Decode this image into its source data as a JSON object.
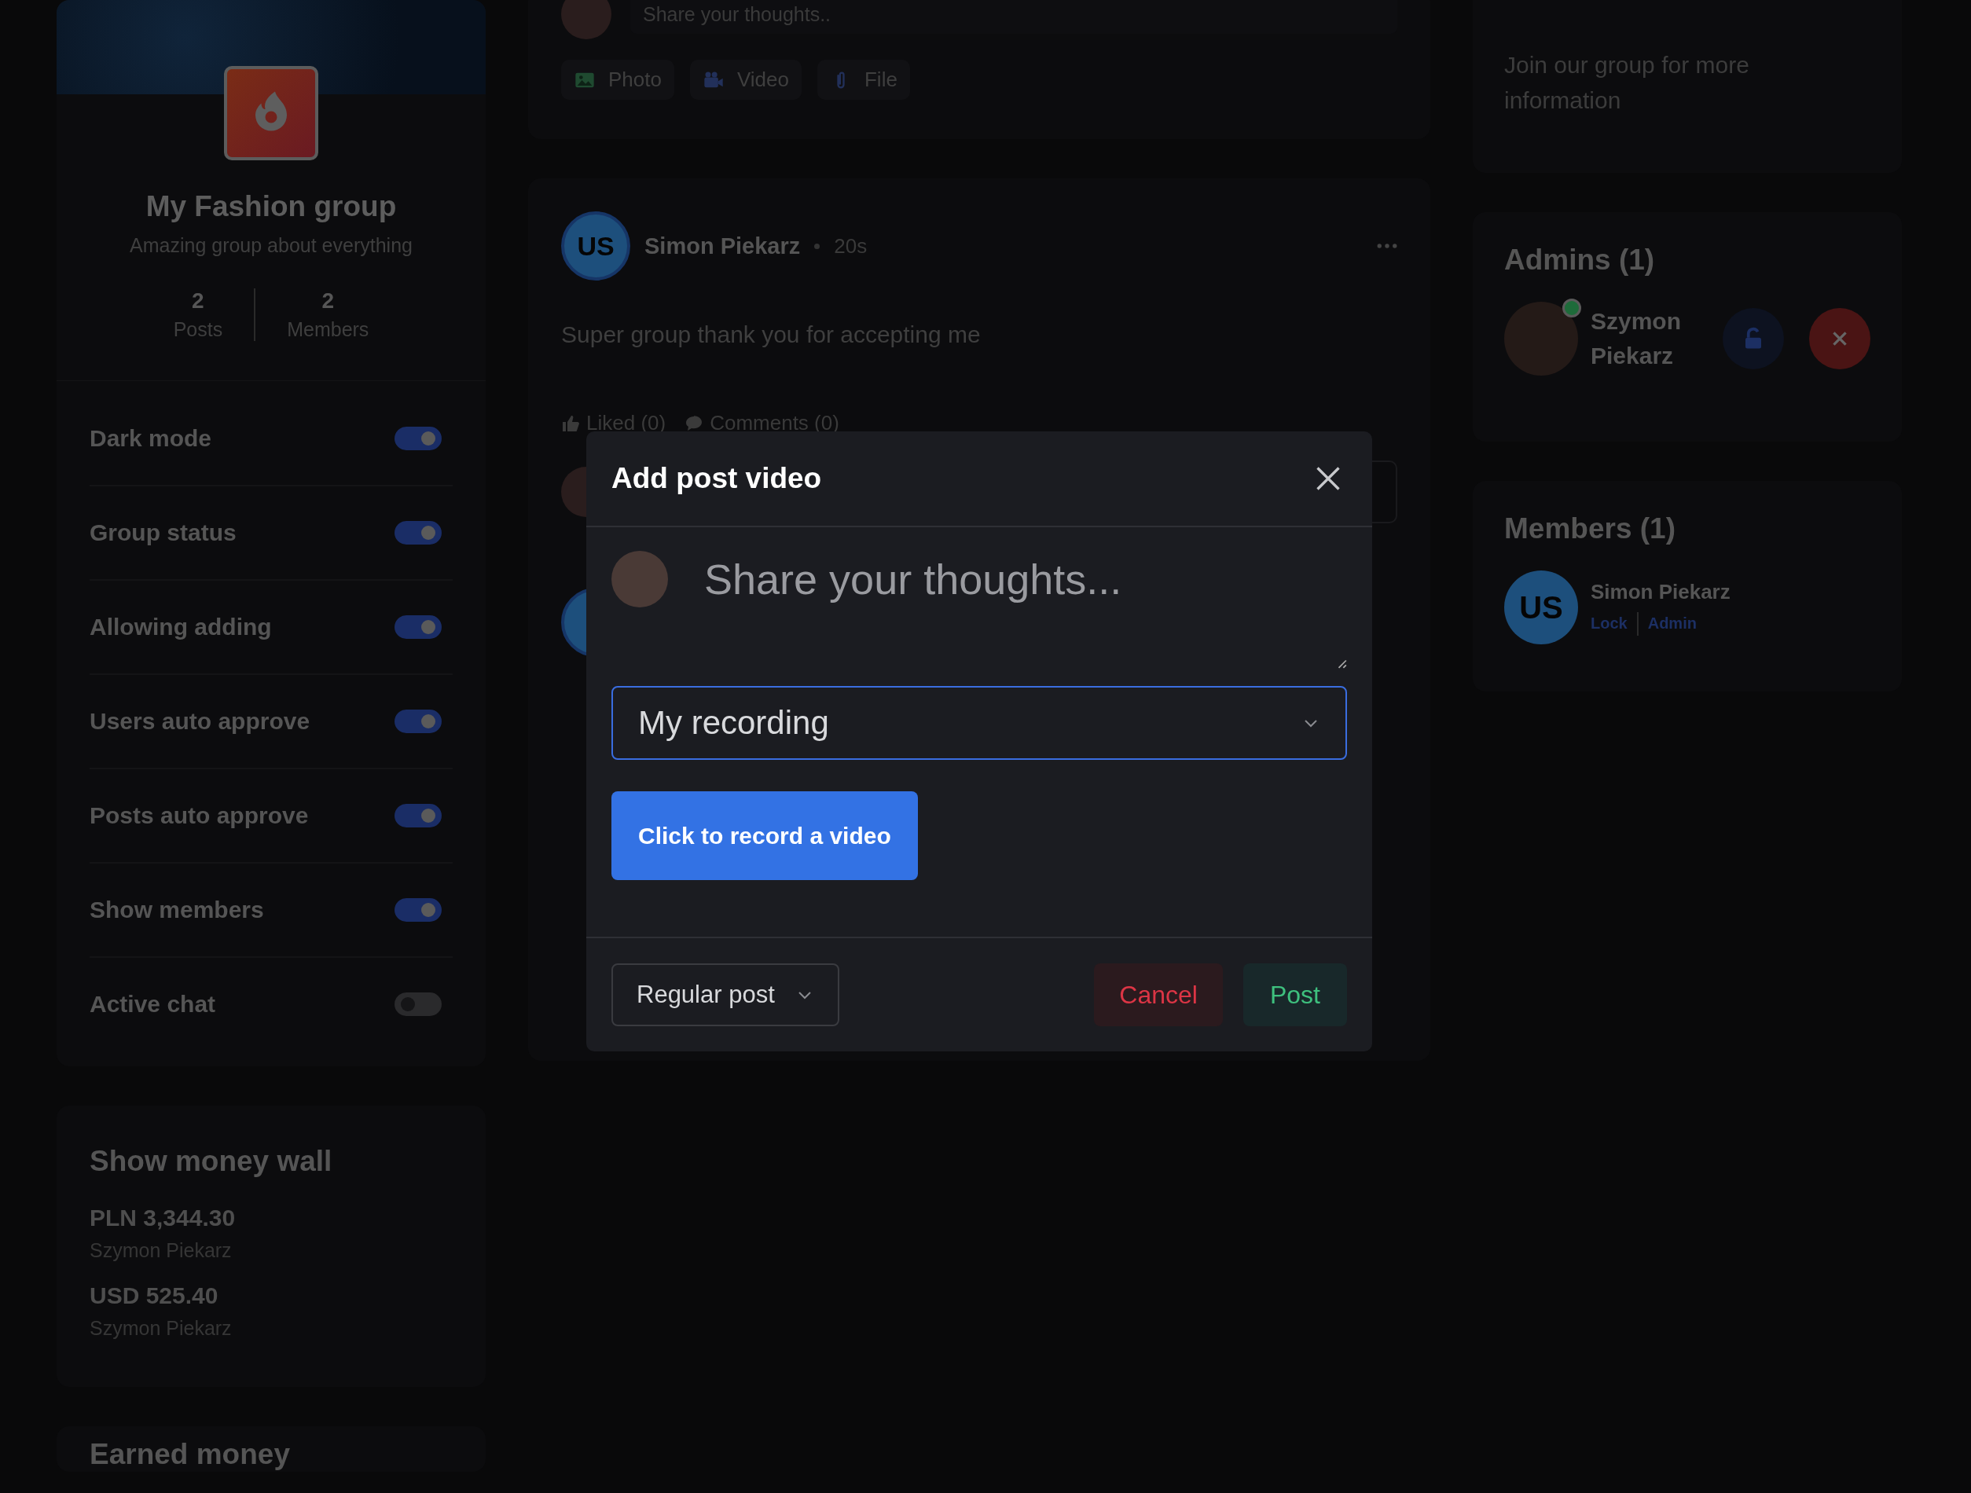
{
  "group": {
    "name": "My Fashion group",
    "tagline": "Amazing group about everything",
    "stats": [
      {
        "value": "2",
        "label": "Posts"
      },
      {
        "value": "2",
        "label": "Members"
      }
    ]
  },
  "settings": [
    {
      "label": "Dark mode",
      "on": true
    },
    {
      "label": "Group status",
      "on": true
    },
    {
      "label": "Allowing adding",
      "on": true
    },
    {
      "label": "Users auto approve",
      "on": true
    },
    {
      "label": "Posts auto approve",
      "on": true
    },
    {
      "label": "Show members",
      "on": true
    },
    {
      "label": "Active chat",
      "on": false
    }
  ],
  "money_wall": {
    "title": "Show money wall",
    "entries": [
      {
        "amount": "PLN 3,344.30",
        "name": "Szymon Piekarz"
      },
      {
        "amount": "USD 525.40",
        "name": "Szymon Piekarz"
      }
    ]
  },
  "earned_money": {
    "title": "Earned money"
  },
  "composer": {
    "placeholder": "Share your thoughts..",
    "attachments": [
      {
        "kind": "photo",
        "label": "Photo"
      },
      {
        "kind": "video",
        "label": "Video"
      },
      {
        "kind": "file",
        "label": "File"
      }
    ]
  },
  "posts": [
    {
      "initials": "US",
      "author": "Simon Piekarz",
      "time": "20s",
      "text": "Super group thank you for accepting me",
      "likes": "Liked (0)",
      "comments": "Comments (0)"
    }
  ],
  "about": {
    "text": "Join our group for more information"
  },
  "admins": {
    "title": "Admins (1)",
    "people": [
      {
        "name": "Szymon Piekarz",
        "online": true
      }
    ]
  },
  "members": {
    "title": "Members (1)",
    "people": [
      {
        "initials": "US",
        "name": "Simon Piekarz",
        "actions": [
          "Lock",
          "Admin"
        ]
      }
    ]
  },
  "modal": {
    "title": "Add post video",
    "placeholder": "Share your thoughts...",
    "source": "My recording",
    "record_button": "Click to record a video",
    "post_type": "Regular post",
    "cancel": "Cancel",
    "submit": "Post"
  }
}
